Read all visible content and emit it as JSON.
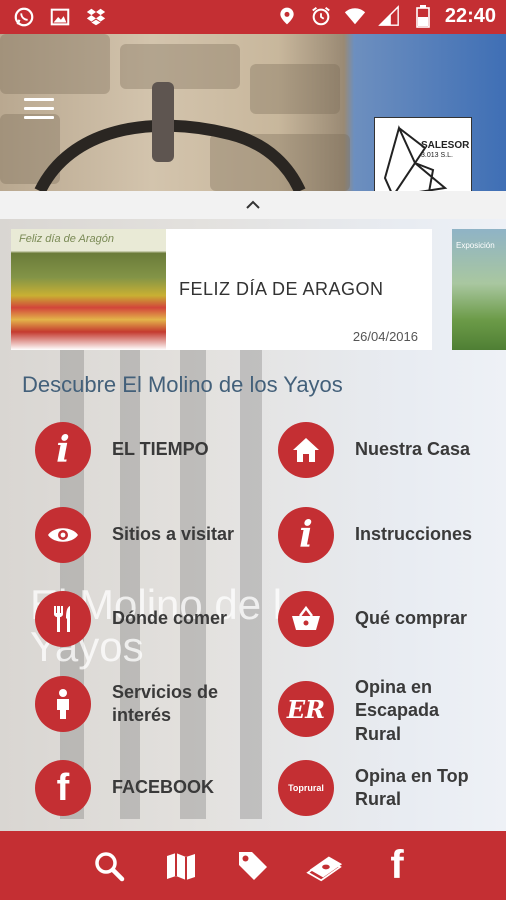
{
  "status_bar": {
    "time": "22:40",
    "left_icons": [
      "whatsapp-icon",
      "image-icon",
      "dropbox-icon"
    ],
    "right_icons": [
      "location-icon",
      "alarm-icon",
      "wifi-icon",
      "signal-icon",
      "battery-icon"
    ]
  },
  "header": {
    "logo_text": "SALESOR",
    "logo_subtext": "3.013 S.L."
  },
  "news": [
    {
      "image_caption": "Feliz día de Aragón",
      "title": "FELIZ DÍA DE ARAGON",
      "date": "26/04/2016"
    },
    {
      "image_caption": "Exposición"
    }
  ],
  "section_title": "Descubre El Molino de los Yayos",
  "background_title": "El Molino de los Yayos",
  "menu": [
    {
      "label": "EL TIEMPO",
      "icon": "info-icon"
    },
    {
      "label": "Nuestra Casa",
      "icon": "home-icon"
    },
    {
      "label": "Sitios a visitar",
      "icon": "eye-icon"
    },
    {
      "label": "Instrucciones",
      "icon": "info-icon"
    },
    {
      "label": "Dónde comer",
      "icon": "fork-knife-icon"
    },
    {
      "label": "Qué comprar",
      "icon": "basket-icon"
    },
    {
      "label": "Servicios de interés",
      "icon": "person-icon"
    },
    {
      "label": "Opina en Escapada Rural",
      "icon": "escapada-rural-icon",
      "icon_text": "ER"
    },
    {
      "label": "FACEBOOK",
      "icon": "facebook-icon",
      "icon_text": "f"
    },
    {
      "label": "Opina en Top Rural",
      "icon": "toprural-icon",
      "icon_text": "Toprural"
    }
  ],
  "bottom_nav": [
    {
      "icon": "search-icon"
    },
    {
      "icon": "map-icon"
    },
    {
      "icon": "tag-icon"
    },
    {
      "icon": "money-icon"
    },
    {
      "icon": "facebook-icon",
      "icon_text": "f"
    }
  ],
  "colors": {
    "primary_red": "#c42f33",
    "section_title": "#43607a",
    "menu_label": "#3a3a3a"
  }
}
